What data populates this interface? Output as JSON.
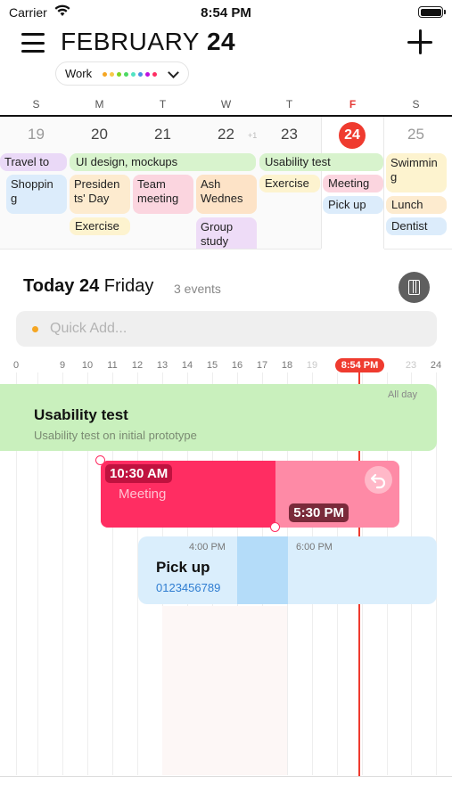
{
  "status_bar": {
    "carrier": "Carrier",
    "time": "8:54 PM"
  },
  "header": {
    "month": "FEBRUARY",
    "day": "24"
  },
  "filter": {
    "label": "Work",
    "dot_colors": [
      "#f5a623",
      "#f7c948",
      "#7ed321",
      "#4cd964",
      "#50e3c2",
      "#4a90e2",
      "#bd10e0",
      "#ff2d62"
    ]
  },
  "week": {
    "weekdays": [
      "S",
      "M",
      "T",
      "W",
      "T",
      "F",
      "S"
    ],
    "days": [
      "19",
      "20",
      "21",
      "22",
      "23",
      "24",
      "25"
    ],
    "extra_indicator": "+1",
    "today_index": 5,
    "events": {
      "travel": "Travel to Je",
      "shopping": "Shoppin g",
      "ui_design": "UI design, mockups",
      "presidents": "Presiden ts' Day",
      "team_meeting": "Team meeting",
      "ash": "Ash Wednes",
      "exercise_mon": "Exercise",
      "group_study": "Group study",
      "usability": "Usability test",
      "exercise_thu": "Exercise",
      "meeting": "Meeting",
      "pickup": "Pick up",
      "swimming": "Swimmin g",
      "lunch": "Lunch",
      "dentist": "Dentist"
    }
  },
  "today": {
    "label": "Today",
    "date": "24",
    "weekday": "Friday",
    "count": "3 events"
  },
  "quick_add": {
    "placeholder": "Quick Add..."
  },
  "timeline": {
    "hours": [
      "0",
      "9",
      "10",
      "11",
      "12",
      "13",
      "14",
      "15",
      "16",
      "17",
      "18",
      "19",
      "23",
      "24"
    ],
    "now": "8:54 PM"
  },
  "events": {
    "usability": {
      "title": "Usability test",
      "subtitle": "Usability test on initial prototype",
      "all_day": "All day"
    },
    "meeting": {
      "start": "10:30 AM",
      "title": "Meeting",
      "end": "5:30 PM"
    },
    "pickup": {
      "title": "Pick up",
      "phone": "0123456789",
      "time1": "4:00 PM",
      "time2": "6:00 PM"
    }
  },
  "colors": {
    "accent_red": "#ef3b2f",
    "meeting": "#ff2d62",
    "pickup": "#daeefc",
    "usability": "#c9f0bd"
  }
}
